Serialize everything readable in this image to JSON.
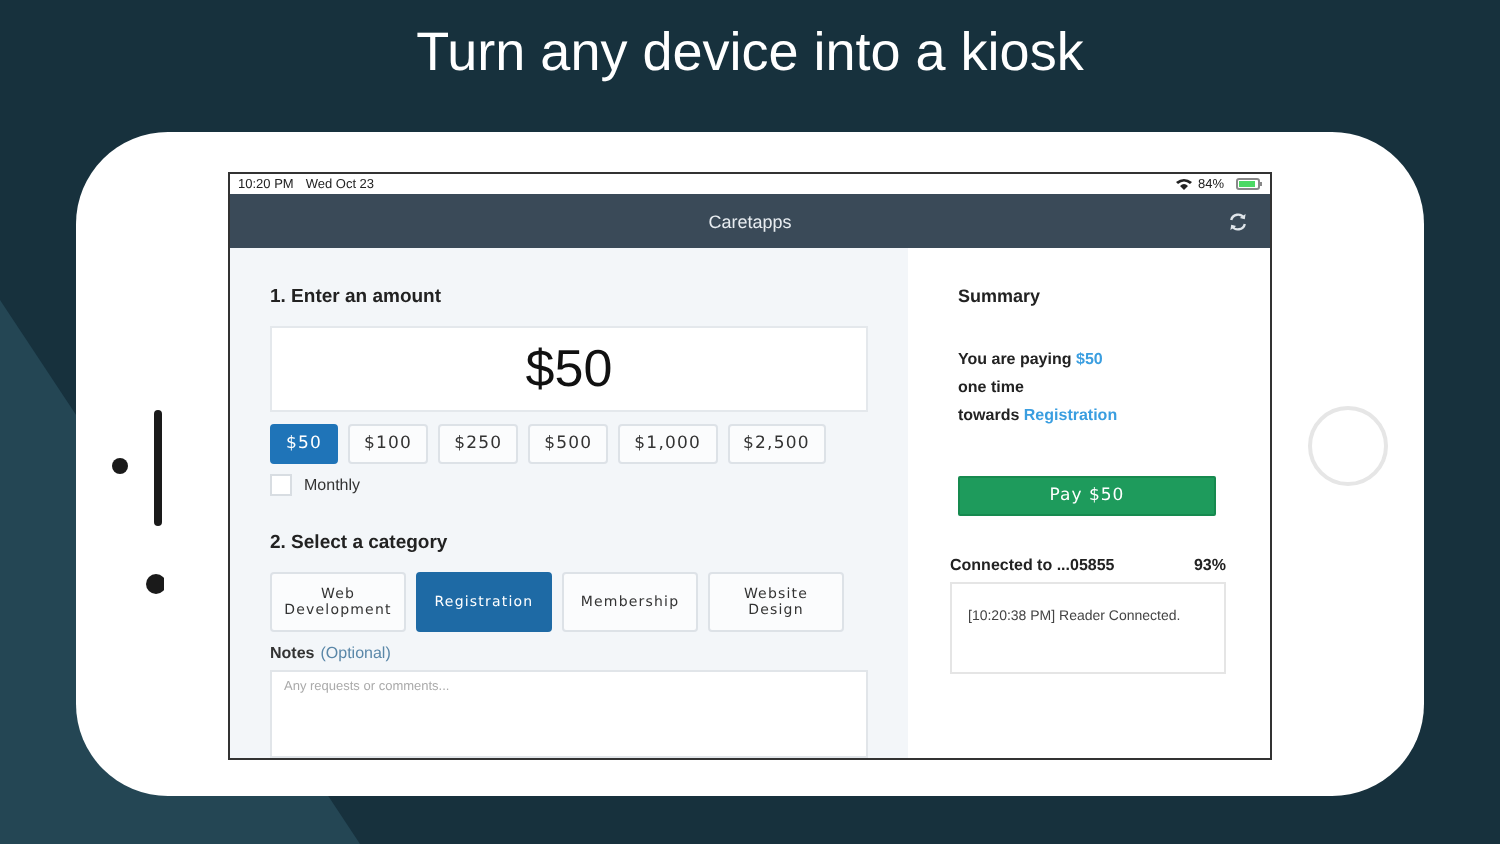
{
  "headline": "Turn any device into a kiosk",
  "status_bar": {
    "time": "10:20 PM",
    "date": "Wed Oct 23",
    "battery": "84%"
  },
  "nav": {
    "title": "Caretapps"
  },
  "amount_section": {
    "heading": "1. Enter an amount",
    "amount": "$50",
    "presets": [
      {
        "label": "$50",
        "selected": true
      },
      {
        "label": "$100",
        "selected": false
      },
      {
        "label": "$250",
        "selected": false
      },
      {
        "label": "$500",
        "selected": false
      },
      {
        "label": "$1,000",
        "selected": false
      },
      {
        "label": "$2,500",
        "selected": false
      }
    ],
    "monthly": {
      "label": "Monthly",
      "checked": false
    }
  },
  "category_section": {
    "heading": "2. Select a category",
    "categories": [
      {
        "label": "Web Development",
        "selected": false
      },
      {
        "label": "Registration",
        "selected": true
      },
      {
        "label": "Membership",
        "selected": false
      },
      {
        "label": "Website Design",
        "selected": false
      }
    ],
    "notes": {
      "label": "Notes",
      "optional": "(Optional)",
      "placeholder": "Any requests or comments..."
    }
  },
  "summary": {
    "heading": "Summary",
    "paying_prefix": "You are paying",
    "paying_amount": "$50",
    "frequency": "one time",
    "towards_prefix": "towards",
    "towards_category": "Registration",
    "pay_button": "Pay $50",
    "connection": "Connected to ...05855",
    "reader_battery": "93%",
    "log": "[10:20:38 PM] Reader Connected."
  }
}
